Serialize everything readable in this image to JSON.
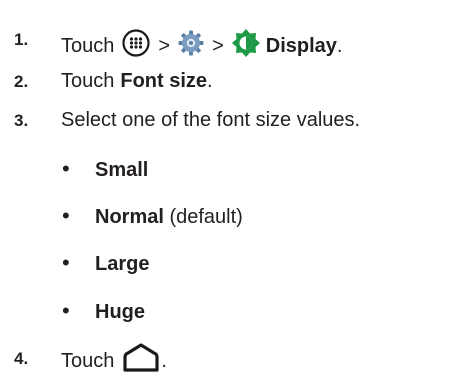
{
  "steps": [
    {
      "number": "1.",
      "touch": "Touch",
      "separator": ">",
      "apps_icon": "apps-grid-icon",
      "settings_icon": "settings-gear-icon",
      "display_icon": "display-brightness-icon",
      "display_label": "Display",
      "end": "."
    },
    {
      "number": "2.",
      "touch": "Touch",
      "target": "Font size",
      "end": "."
    },
    {
      "number": "3.",
      "text": "Select one of the font size values."
    },
    {
      "number": "4.",
      "touch": "Touch",
      "home_icon": "home-button-icon",
      "end": "."
    }
  ],
  "font_sizes": [
    {
      "label": "Small",
      "note": ""
    },
    {
      "label": "Normal",
      "note": "(default)"
    },
    {
      "label": "Large",
      "note": ""
    },
    {
      "label": "Huge",
      "note": ""
    }
  ],
  "bullet_symbol": "•",
  "colors": {
    "text": "#231f20",
    "icon_dark": "#1a1a1a",
    "settings_blue": "#5a7fa6",
    "display_green": "#1e9a46"
  }
}
